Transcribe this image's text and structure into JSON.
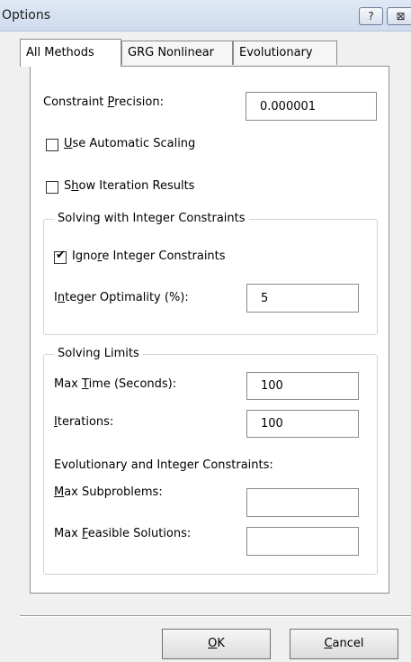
{
  "window": {
    "title": "Options",
    "help_glyph": "?",
    "close_glyph": "⊠"
  },
  "tabs": [
    {
      "label": "All Methods",
      "active": true
    },
    {
      "label": "GRG Nonlinear",
      "active": false
    },
    {
      "label": "Evolutionary",
      "active": false
    }
  ],
  "constraint_precision": {
    "label_pre": "Constraint ",
    "label_u": "P",
    "label_post": "recision:",
    "value": "0.000001"
  },
  "use_automatic_scaling": {
    "label_u": "U",
    "label_post": "se Automatic Scaling",
    "checked": false
  },
  "show_iteration_results": {
    "label_pre": "S",
    "label_u": "h",
    "label_post": "ow Iteration Results",
    "checked": false
  },
  "integer_group": {
    "title": "Solving with Integer Constraints",
    "ignore": {
      "label_pre": "Igno",
      "label_u": "r",
      "label_post": "e Integer Constraints",
      "checked": true,
      "check_glyph": "✔"
    },
    "optimality": {
      "label_pre": "I",
      "label_u": "n",
      "label_post": "teger Optimality (%):",
      "value": "5"
    }
  },
  "limits_group": {
    "title": "Solving Limits",
    "max_time": {
      "label_pre": "Max ",
      "label_u": "T",
      "label_post": "ime (Seconds):",
      "value": "100"
    },
    "iterations": {
      "label_u": "I",
      "label_post": "terations:",
      "value": "100"
    },
    "evo_heading": "Evolutionary and Integer Constraints:",
    "max_subproblems": {
      "label_u": "M",
      "label_post": "ax Subproblems:",
      "value": ""
    },
    "max_feasible": {
      "label_pre": "Max ",
      "label_u": "F",
      "label_post": "easible Solutions:",
      "value": ""
    }
  },
  "buttons": {
    "ok_u": "O",
    "ok_post": "K",
    "cancel_u": "C",
    "cancel_post": "ancel"
  }
}
